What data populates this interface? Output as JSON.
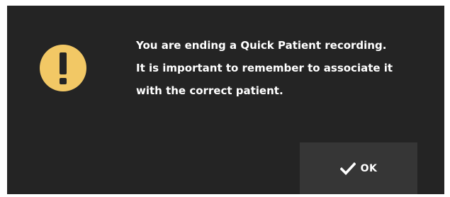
{
  "dialog": {
    "icon": "warning-icon",
    "icon_color": "#F2C865",
    "message_lines": [
      "You are ending a Quick Patient recording.",
      "It is important to remember to associate it",
      "with the correct patient."
    ],
    "ok_button": {
      "icon": "checkmark-icon",
      "label": "OK"
    }
  }
}
